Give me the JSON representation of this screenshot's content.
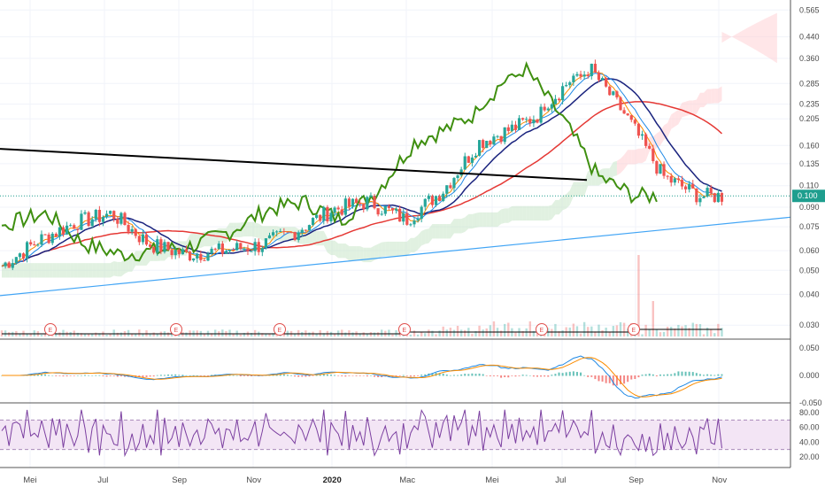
{
  "chart_data": [
    {
      "type": "candlestick",
      "title": "",
      "y_scale": "log",
      "ylim": [
        0.027,
        0.6
      ],
      "y_ticks": [
        "0.565",
        "0.440",
        "0.360",
        "0.285",
        "0.235",
        "0.205",
        "0.160",
        "0.135",
        "0.110",
        "0.090",
        "0.075",
        "0.060",
        "0.050",
        "0.040",
        "0.030"
      ],
      "x_ticks": [
        "Mei",
        "Jul",
        "Sep",
        "Nov",
        "2020",
        "Mac",
        "Mei",
        "Jul",
        "Sep",
        "Nov"
      ],
      "x_tick_bold": "2020",
      "current_price_label": "0.100",
      "approx_close_path": [
        {
          "date": "2019-04",
          "close": 0.052
        },
        {
          "date": "2019-05",
          "close": 0.066
        },
        {
          "date": "2019-06",
          "close": 0.078
        },
        {
          "date": "2019-07",
          "close": 0.085
        },
        {
          "date": "2019-08",
          "close": 0.064
        },
        {
          "date": "2019-09",
          "close": 0.058
        },
        {
          "date": "2019-10",
          "close": 0.06
        },
        {
          "date": "2019-11",
          "close": 0.063
        },
        {
          "date": "2019-12",
          "close": 0.072
        },
        {
          "date": "2020-01",
          "close": 0.088
        },
        {
          "date": "2020-02",
          "close": 0.095
        },
        {
          "date": "2020-03",
          "close": 0.08
        },
        {
          "date": "2020-04",
          "close": 0.105
        },
        {
          "date": "2020-05",
          "close": 0.165
        },
        {
          "date": "2020-06",
          "close": 0.19
        },
        {
          "date": "2020-07",
          "close": 0.23
        },
        {
          "date": "2020-08",
          "close": 0.33
        },
        {
          "date": "2020-09",
          "close": 0.21
        },
        {
          "date": "2020-10",
          "close": 0.12
        },
        {
          "date": "2020-11",
          "close": 0.1
        }
      ],
      "earnings_markers": [
        "E",
        "E",
        "E",
        "E",
        "E",
        "E"
      ],
      "colors": {
        "up": "#26a69a",
        "down": "#ef5350",
        "ma_red": "#e53935",
        "ma_navy": "#1a237e",
        "ma_blue": "#1e88e5",
        "ma_orange": "#fb8c00",
        "lagging_green": "#3f8f10",
        "trendline_black": "#000000",
        "trendline_blue": "#42a5f5",
        "cloud_green": "#c8e6c9",
        "cloud_red": "#ffcdd2",
        "price_label": "#1e9e8e"
      }
    },
    {
      "type": "macd",
      "y_ticks": [
        "0.050",
        "0.000",
        "-0.050"
      ],
      "colors": {
        "macd": "#1e88e5",
        "signal": "#fb8c00"
      }
    },
    {
      "type": "rsi",
      "y_ticks": [
        "80.00",
        "60.00",
        "40.00",
        "20.00"
      ],
      "band": [
        30,
        70
      ],
      "colors": {
        "rsi": "#7b3fa0",
        "band": "#f3e5f5"
      }
    }
  ]
}
